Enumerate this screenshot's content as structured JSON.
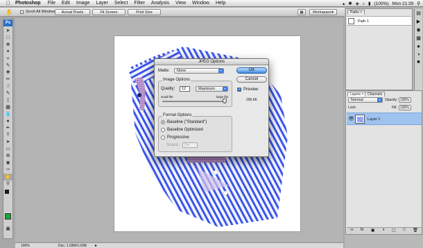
{
  "menubar": {
    "app_name": "Photoshop",
    "menus": [
      "File",
      "Edit",
      "Image",
      "Layer",
      "Select",
      "Filter",
      "Analysis",
      "View",
      "Window",
      "Help"
    ],
    "battery": "(100%)",
    "clock": "Mon 21:39"
  },
  "options_bar": {
    "scroll_all_windows": "Scroll All Windows",
    "actual_pixels": "Actual Pixels",
    "fit_screen": "Fit Screen",
    "print_size": "Print Size",
    "workspace": "Workspace"
  },
  "toolbox": {
    "logo": "Ps"
  },
  "status_bar": {
    "zoom": "100%",
    "doc_info": "Doc: 1.03M/1.03M"
  },
  "paths_panel": {
    "tab": "Paths",
    "item": "Path 1"
  },
  "layers_panel": {
    "tabs": [
      "Layers",
      "Channels"
    ],
    "blend_mode": "Normal",
    "opacity_label": "Opacity:",
    "opacity_value": "100%",
    "fill_label": "Fill:",
    "fill_value": "100%",
    "lock_label": "Lock:",
    "layer_name": "Layer 1"
  },
  "dialog": {
    "title": "JPEG Options",
    "matte_label": "Matte:",
    "matte_value": "None",
    "ok_label": "OK",
    "cancel_label": "Cancel",
    "preview_label": "Preview",
    "file_size": "296.6K",
    "image_options_title": "Image Options",
    "quality_label": "Quality:",
    "quality_value": "12",
    "quality_preset": "Maximum",
    "small_file_label": "small file",
    "large_file_label": "large file",
    "quality_fraction": 1.0,
    "format_options_title": "Format Options",
    "format_baseline_standard": "Baseline (\"Standard\")",
    "format_baseline_optimized": "Baseline Optimized",
    "format_progressive": "Progressive",
    "scans_label": "Scans:",
    "scans_value": "3"
  },
  "colors": {
    "foreground": "#1a1a1a",
    "background": "#ffffff",
    "shirt_stripe": "#3b55e8",
    "accent": "#3d7de0",
    "selected_layer": "#9fc3f0"
  }
}
